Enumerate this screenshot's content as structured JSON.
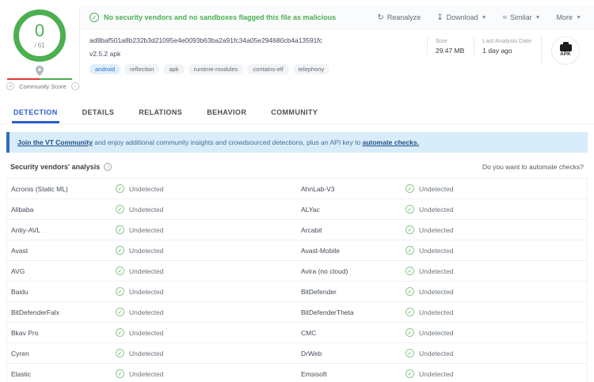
{
  "colors": {
    "green": "#4caf50",
    "red": "#e53935",
    "tab_blue": "#2b5ecd",
    "banner_bg": "#d9ecf9"
  },
  "score": {
    "positives": "0",
    "total": "/ 61",
    "community_label": "Community Score"
  },
  "verdict": {
    "message": "No security vendors and no sandboxes flagged this file as malicious"
  },
  "actions": [
    {
      "name": "reanalyze",
      "icon": "↻",
      "label": "Reanalyze",
      "caret": false
    },
    {
      "name": "download",
      "icon": "↧",
      "label": "Download",
      "caret": true
    },
    {
      "name": "similar",
      "icon": "≈",
      "label": "Similar",
      "caret": true
    },
    {
      "name": "more",
      "icon": "",
      "label": "More",
      "caret": true
    }
  ],
  "file": {
    "hash": "ad8baf501a8b232b3d21095e4e0093b63ba2a91fc34a05e294680cb4a13591fc",
    "name": "v2.5.2 apk",
    "tags": [
      {
        "label": "android",
        "accent": true
      },
      {
        "label": "reflection",
        "accent": false
      },
      {
        "label": "apk",
        "accent": false
      },
      {
        "label": "runtime-modules",
        "accent": false
      },
      {
        "label": "contains-elf",
        "accent": false
      },
      {
        "label": "telephony",
        "accent": false
      }
    ],
    "size_label": "Size",
    "size_value": "29.47 MB",
    "date_label": "Last Analysis Date",
    "date_value": "1 day ago",
    "filetype_badge": "APK"
  },
  "tabs": [
    {
      "label": "DETECTION",
      "active": true
    },
    {
      "label": "DETAILS",
      "active": false
    },
    {
      "label": "RELATIONS",
      "active": false
    },
    {
      "label": "BEHAVIOR",
      "active": false
    },
    {
      "label": "COMMUNITY",
      "active": false
    }
  ],
  "banner": {
    "link1": "Join the VT Community",
    "middle": " and enjoy additional community insights and crowdsourced detections, plus an API key to ",
    "link2": "automate checks."
  },
  "analysis": {
    "title": "Security vendors' analysis",
    "automate": "Do you want to automate checks?",
    "rows": [
      {
        "left": {
          "name": "Acronis (Static ML)",
          "status": "Undetected"
        },
        "right": {
          "name": "AhnLab-V3",
          "status": "Undetected"
        }
      },
      {
        "left": {
          "name": "Alibaba",
          "status": "Undetected"
        },
        "right": {
          "name": "ALYac",
          "status": "Undetected"
        }
      },
      {
        "left": {
          "name": "Antiy-AVL",
          "status": "Undetected"
        },
        "right": {
          "name": "Arcabit",
          "status": "Undetected"
        }
      },
      {
        "left": {
          "name": "Avast",
          "status": "Undetected"
        },
        "right": {
          "name": "Avast-Mobile",
          "status": "Undetected"
        }
      },
      {
        "left": {
          "name": "AVG",
          "status": "Undetected"
        },
        "right": {
          "name": "Avira (no cloud)",
          "status": "Undetected"
        }
      },
      {
        "left": {
          "name": "Baidu",
          "status": "Undetected"
        },
        "right": {
          "name": "BitDefender",
          "status": "Undetected"
        }
      },
      {
        "left": {
          "name": "BitDefenderFalx",
          "status": "Undetected"
        },
        "right": {
          "name": "BitDefenderTheta",
          "status": "Undetected"
        }
      },
      {
        "left": {
          "name": "Bkav Pro",
          "status": "Undetected"
        },
        "right": {
          "name": "CMC",
          "status": "Undetected"
        }
      },
      {
        "left": {
          "name": "Cyren",
          "status": "Undetected"
        },
        "right": {
          "name": "DrWeb",
          "status": "Undetected"
        }
      },
      {
        "left": {
          "name": "Elastic",
          "status": "Undetected"
        },
        "right": {
          "name": "Emsisoft",
          "status": "Undetected"
        }
      }
    ]
  }
}
